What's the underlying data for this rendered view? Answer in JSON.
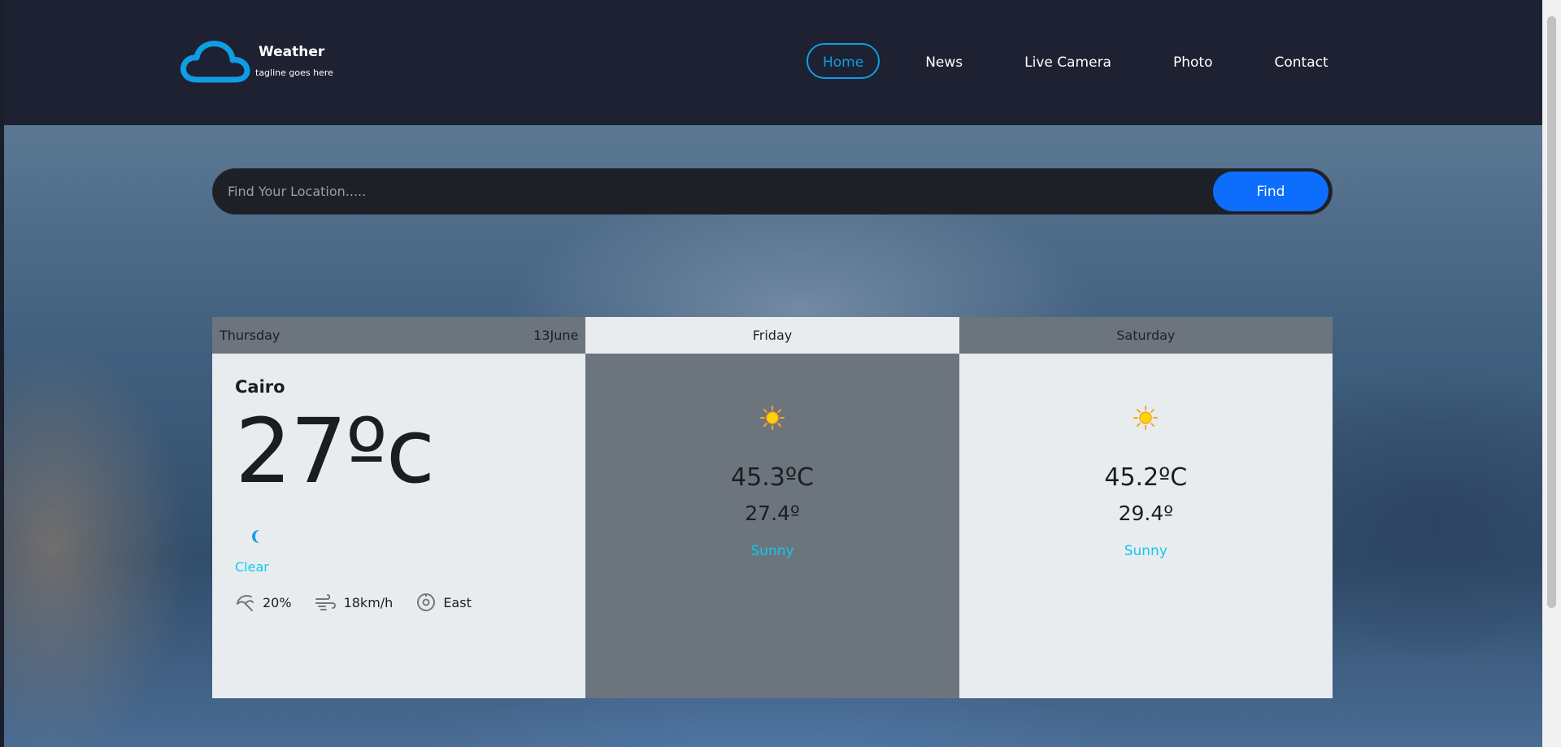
{
  "brand": {
    "name": "Weather",
    "tagline": "tagline goes here"
  },
  "nav": [
    {
      "label": "Home",
      "active": true
    },
    {
      "label": "News"
    },
    {
      "label": "Live Camera"
    },
    {
      "label": "Photo"
    },
    {
      "label": "Contact"
    }
  ],
  "search": {
    "placeholder": "Find Your Location.....",
    "value": "",
    "button_label": "Find"
  },
  "today": {
    "day": "Thursday",
    "date": "13June",
    "city": "Cairo",
    "temp": "27ºc",
    "condition": "Clear",
    "icon": "moon-icon",
    "humidity": "20%",
    "wind_speed": "18km/h",
    "wind_direction": "East"
  },
  "forecast": [
    {
      "day": "Friday",
      "high": "45.3ºC",
      "low": "27.4º",
      "condition": "Sunny",
      "icon": "sun-icon"
    },
    {
      "day": "Saturday",
      "high": "45.2ºC",
      "low": "29.4º",
      "condition": "Sunny",
      "icon": "sun-icon"
    }
  ],
  "colors": {
    "header_bg": "#1e2131",
    "accent": "#0d9ee6",
    "find_button": "#0d6efd",
    "condition_text": "#0dcaf0",
    "card_light": "#e9ecef",
    "card_dark": "#6c757d"
  }
}
